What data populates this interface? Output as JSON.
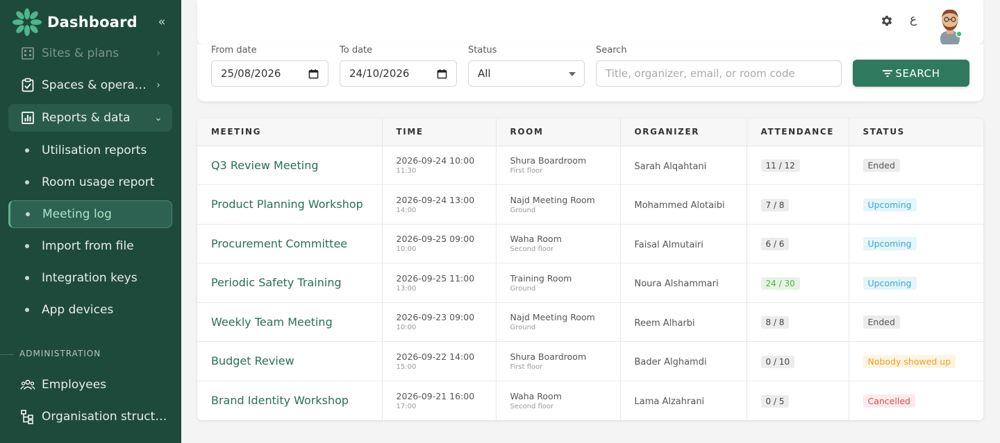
{
  "sidebar": {
    "brand": "Dashboard",
    "items": [
      {
        "label": "Sites & plans",
        "icon": "building-icon",
        "faded": true,
        "chevron": "›"
      },
      {
        "label": "Spaces & operations",
        "icon": "clipboard-check-icon",
        "chevron": "›"
      },
      {
        "label": "Reports & data",
        "icon": "bar-chart-icon",
        "chevron": "⌄",
        "expanded": true
      }
    ],
    "sub_items": [
      {
        "label": "Utilisation reports"
      },
      {
        "label": "Room usage report"
      },
      {
        "label": "Meeting log",
        "active": true
      },
      {
        "label": "Import from file"
      },
      {
        "label": "Integration keys"
      },
      {
        "label": "App devices"
      }
    ],
    "section_label": "ADMINISTRATION",
    "admin_items": [
      {
        "label": "Employees",
        "icon": "people-icon"
      },
      {
        "label": "Organisation structure",
        "icon": "org-tree-icon"
      }
    ]
  },
  "header": {
    "language_toggle": "ع"
  },
  "filters": {
    "from_label": "From date",
    "from_value": "25/08/2026",
    "to_label": "To date",
    "to_value": "24/10/2026",
    "status_label": "Status",
    "status_value": "All",
    "search_label": "Search",
    "search_placeholder": "Title, organizer, email, or room code",
    "search_button": "SEARCH"
  },
  "table": {
    "columns": [
      "MEETING",
      "TIME",
      "ROOM",
      "ORGANIZER",
      "ATTENDANCE",
      "STATUS"
    ],
    "rows": [
      {
        "meeting": "Q3 Review Meeting",
        "start": "2026-09-24 10:00",
        "end": "11:30",
        "room": "Shura Boardroom",
        "floor": "First floor",
        "organizer": "Sarah Alqahtani",
        "attendance": "11 / 12",
        "status": "Ended",
        "status_type": "ended"
      },
      {
        "meeting": "Product Planning Workshop",
        "start": "2026-09-24 13:00",
        "end": "14:00",
        "room": "Najd Meeting Room",
        "floor": "Ground",
        "organizer": "Mohammed Alotaibi",
        "attendance": "7 / 8",
        "status": "Upcoming",
        "status_type": "upcoming"
      },
      {
        "meeting": "Procurement Committee",
        "start": "2026-09-25 09:00",
        "end": "10:00",
        "room": "Waha Room",
        "floor": "Second floor",
        "organizer": "Faisal Almutairi",
        "attendance": "6 / 6",
        "status": "Upcoming",
        "status_type": "upcoming"
      },
      {
        "meeting": "Periodic Safety Training",
        "start": "2026-09-25 11:00",
        "end": "13:00",
        "room": "Training Room",
        "floor": "Ground",
        "organizer": "Noura Alshammari",
        "attendance": "24 / 30",
        "attendance_type": "full",
        "status": "Upcoming",
        "status_type": "upcoming"
      },
      {
        "meeting": "Weekly Team Meeting",
        "start": "2026-09-23 09:00",
        "end": "10:00",
        "room": "Najd Meeting Room",
        "floor": "Ground",
        "organizer": "Reem Alharbi",
        "attendance": "8 / 8",
        "status": "Ended",
        "status_type": "ended"
      },
      {
        "meeting": "Budget Review",
        "start": "2026-09-22 14:00",
        "end": "15:00",
        "room": "Shura Boardroom",
        "floor": "First floor",
        "organizer": "Bader Alghamdi",
        "attendance": "0 / 10",
        "status": "Nobody showed up",
        "status_type": "noshow"
      },
      {
        "meeting": "Brand Identity Workshop",
        "start": "2026-09-21 16:00",
        "end": "17:00",
        "room": "Waha Room",
        "floor": "Second floor",
        "organizer": "Lama Alzahrani",
        "attendance": "0 / 5",
        "status": "Cancelled",
        "status_type": "cancelled"
      }
    ]
  },
  "colors": {
    "sidebar_bg": "#1e4a3c",
    "accent": "#2f7a5e",
    "link": "#2a6e55",
    "status_ended_bg": "#ececec",
    "status_ended_fg": "#555555",
    "status_upcoming_bg": "#e4f5fb",
    "status_upcoming_fg": "#3aa8cf",
    "status_noshow_bg": "#fff4e0",
    "status_noshow_fg": "#e6a22b",
    "status_cancelled_bg": "#fdeaea",
    "status_cancelled_fg": "#d9534f"
  }
}
